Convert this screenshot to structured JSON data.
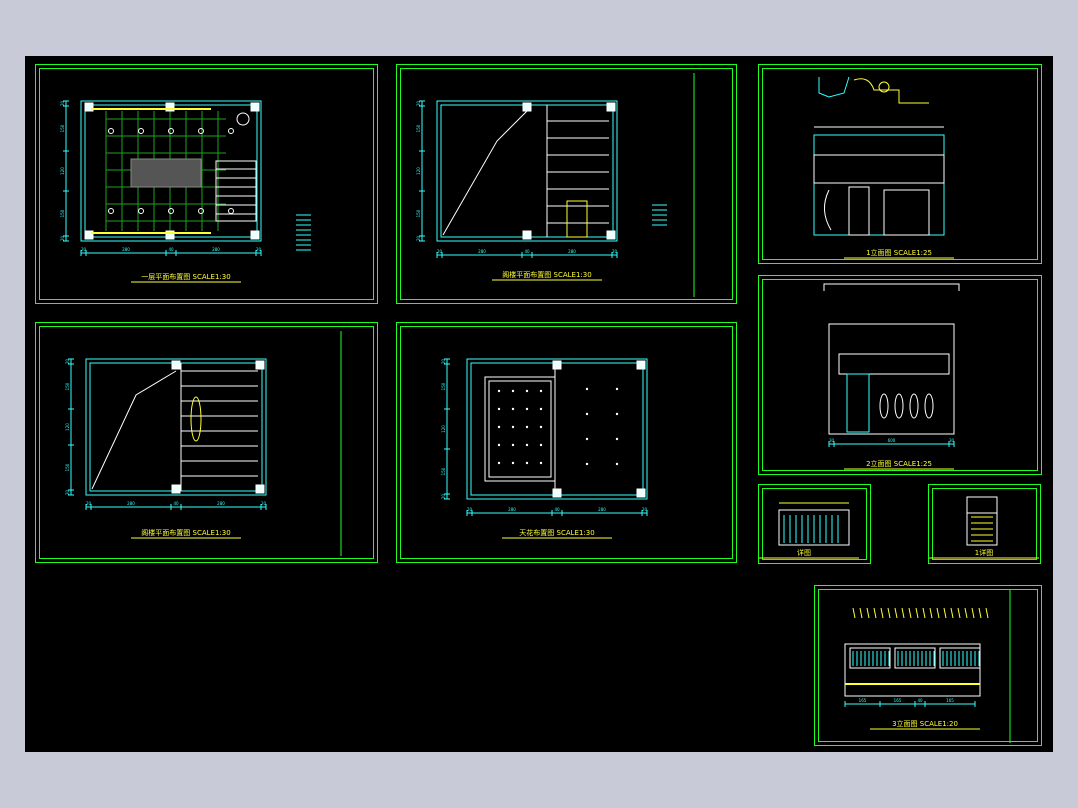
{
  "drawing": {
    "background": "#000000",
    "frame_color": "#1fff1f",
    "line_cyan": "#33ffff",
    "line_white": "#ffffff",
    "line_yellow": "#ffff33",
    "panels": [
      {
        "name": "panel-first-floor-plan",
        "caption_cn": "一层平面布置图",
        "scale": "SCALE1:30"
      },
      {
        "name": "panel-mezzanine-plan-a",
        "caption_cn": "阁楼平面布置图",
        "scale": "SCALE1:30"
      },
      {
        "name": "panel-elevation-a",
        "caption_cn": "1立面图",
        "scale": "SCALE1:25"
      },
      {
        "name": "panel-mezzanine-plan-b",
        "caption_cn": "阁楼平面布置图",
        "scale": "SCALE1:30"
      },
      {
        "name": "panel-ceiling-plan",
        "caption_cn": "天花布置图",
        "scale": "SCALE1:30"
      },
      {
        "name": "panel-elevation-b",
        "caption_cn": "2立面图",
        "scale": "SCALE1:25"
      },
      {
        "name": "panel-detail-a",
        "caption_cn": "详图",
        "scale": ""
      },
      {
        "name": "panel-detail-b",
        "caption_cn": "1详图",
        "scale": ""
      },
      {
        "name": "panel-elevation-c",
        "caption_cn": "3立面图",
        "scale": "SCALE1:20"
      }
    ],
    "dims": {
      "plan_bottom": [
        "20",
        "280",
        "40",
        "280",
        "20"
      ],
      "plan_left": [
        "20",
        "150",
        "120",
        "150",
        "20"
      ],
      "elev_b_bottom": [
        "30",
        "600",
        "30"
      ],
      "elev_c_bottom": [
        "165",
        "165",
        "40",
        "165"
      ]
    }
  }
}
